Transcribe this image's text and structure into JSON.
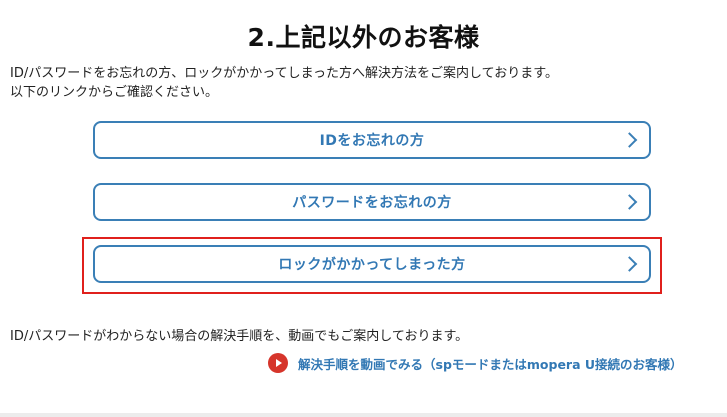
{
  "page": {
    "title": "2.上記以外のお客様"
  },
  "intro": {
    "line1": "ID/パスワードをお忘れの方、ロックがかかってしまった方へ解決方法をご案内しております。",
    "line2": "以下のリンクからご確認ください。"
  },
  "links": [
    {
      "label": "IDをお忘れの方",
      "icon": "chevron-right-icon"
    },
    {
      "label": "パスワードをお忘れの方",
      "icon": "chevron-right-icon"
    },
    {
      "label": "ロックがかかってしまった方",
      "icon": "chevron-right-icon",
      "highlighted": true
    }
  ],
  "note": {
    "text": "ID/パスワードがわからない場合の解決手順を、動画でもご案内しております。"
  },
  "video_link": {
    "label": "解決手順を動画でみる（spモードまたはmopera U接続のお客様）",
    "icon": "play-circle-icon"
  },
  "colors": {
    "accent_blue": "#3278b4",
    "highlight_red": "#e0201c",
    "play_red": "#d6352b"
  }
}
